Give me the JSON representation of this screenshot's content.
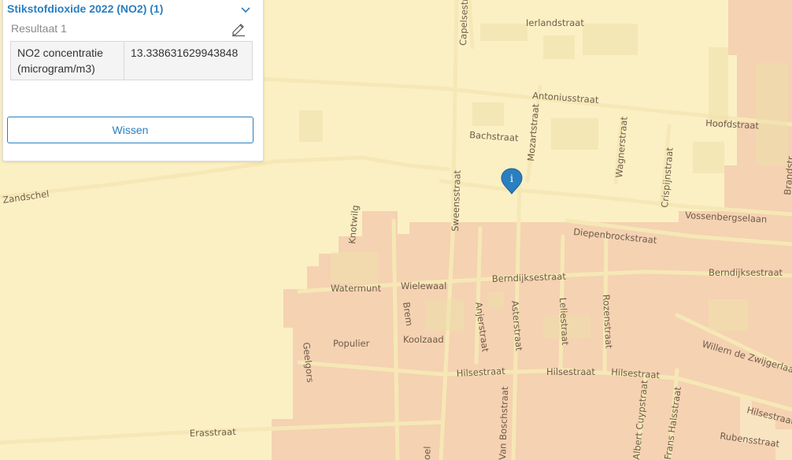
{
  "panel": {
    "layer_title": "Stikstofdioxide 2022 (NO2) (1)",
    "result_label": "Resultaat 1",
    "attributes": [
      {
        "name": "NO2 concentratie (microgram/m3)",
        "value": "13.338631629943848"
      }
    ],
    "clear_label": "Wissen"
  },
  "marker": {
    "label": "i",
    "color": "#2a7fc0"
  },
  "colors": {
    "low_zone": "#fbf0c4",
    "high_zone": "#f5d2b2",
    "accent": "#2a7fc0"
  },
  "streets": [
    "Ierlandstraat",
    "Capelsestraat",
    "Antoniusstraat",
    "Hoofdstraat",
    "Bachstraat",
    "Mozartstraat",
    "Wagnerstraat",
    "Crispijnstraat",
    "Zandschel",
    "Sweensstraat",
    "Knotwilg",
    "Vossenbergselaan",
    "Diepenbrockstraat",
    "Berndijksestraat",
    "Watermunt",
    "Wielewaal",
    "Brem",
    "Anjerstraat",
    "Asterstraat",
    "Leliestraat",
    "Rozenstraat",
    "Populier",
    "Koolzaad",
    "Geelgors",
    "Willem de Zwijgerlaan",
    "Hilsestraat",
    "Erasstraat",
    "Rubensstraat",
    "Brandstr",
    "Frans Halsstraat",
    "Albert Cuypstraat",
    "Van Boschstraat",
    "oel"
  ]
}
